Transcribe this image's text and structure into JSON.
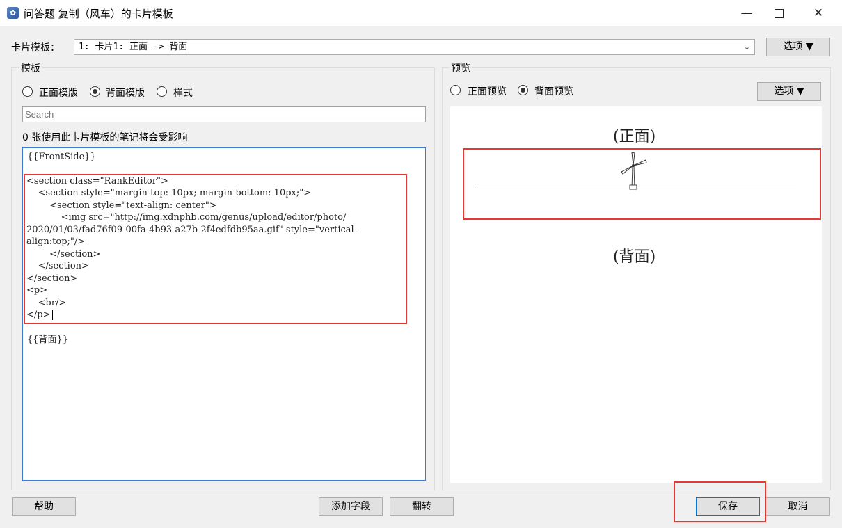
{
  "window": {
    "title": "问答题 复制（风车）的卡片模板",
    "minimize_symbol": "—",
    "close_symbol": "✕"
  },
  "card_template": {
    "label": "卡片模板：",
    "selected": "1: 卡片1: 正面 -> 背面",
    "options_button": "选项 ▼"
  },
  "template_group": {
    "title": "模板",
    "radios": [
      {
        "label": "正面模版",
        "checked": false
      },
      {
        "label": "背面模版",
        "checked": true
      },
      {
        "label": "样式",
        "checked": false
      }
    ],
    "search_placeholder": "Search",
    "affected_notice": "0 张使用此卡片模板的笔记将会受影响",
    "code_lines": [
      "{{FrontSide}}",
      "",
      "<section class=\"RankEditor\">",
      "    <section style=\"margin-top: 10px; margin-bottom: 10px;\">",
      "        <section style=\"text-align: center\">",
      "            <img src=\"http://img.xdnphb.com/genus/upload/editor/photo/",
      "2020/01/03/fad76f09-00fa-4b93-a27b-2f4edfdb95aa.gif\" style=\"vertical-",
      "align:top;\"/>",
      "        </section>",
      "    </section>",
      "</section>",
      "<p>",
      "    <br/>",
      "</p>",
      "",
      "{{背面}}"
    ]
  },
  "preview_group": {
    "title": "预览",
    "radios": [
      {
        "label": "正面预览",
        "checked": false
      },
      {
        "label": "背面预览",
        "checked": true
      }
    ],
    "options_button": "选项 ▼",
    "front_text": "(正面)",
    "back_text": "(背面)"
  },
  "footer": {
    "help": "帮助",
    "add_field": "添加字段",
    "flip": "翻转",
    "save": "保存",
    "cancel": "取消"
  },
  "annotation_color": "#e53935"
}
